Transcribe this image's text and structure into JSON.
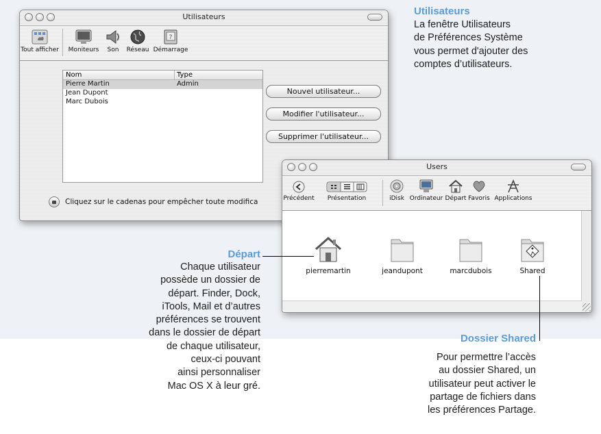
{
  "users_window": {
    "title": "Utilisateurs",
    "toolbar": [
      {
        "label": "Tout afficher",
        "icon": "show-all-icon"
      },
      {
        "label": "Moniteurs",
        "icon": "monitor-icon"
      },
      {
        "label": "Son",
        "icon": "speaker-icon"
      },
      {
        "label": "Réseau",
        "icon": "globe-icon"
      },
      {
        "label": "Démarrage",
        "icon": "startup-disk-icon"
      }
    ],
    "columns": [
      "Nom",
      "Type"
    ],
    "rows": [
      {
        "name": "Pierre Martin",
        "type": "Admin"
      },
      {
        "name": "Jean Dupont",
        "type": ""
      },
      {
        "name": "Marc Dubois",
        "type": ""
      }
    ],
    "buttons": {
      "new": "Nouvel utilisateur...",
      "edit": "Modifier l'utilisateur...",
      "delete": "Supprimer l'utilisateur..."
    },
    "lock_text": "Cliquez sur le cadenas pour empêcher toute modifica"
  },
  "finder_window": {
    "title": "Users",
    "toolbar": {
      "back": "Précédent",
      "view": "Présentation",
      "idisk": "iDisk",
      "computer": "Ordinateur",
      "home": "Départ",
      "favorites": "Favoris",
      "applications": "Applications"
    },
    "items": [
      {
        "label": "pierremartin",
        "icon": "home-folder-icon"
      },
      {
        "label": "jeandupont",
        "icon": "folder-icon"
      },
      {
        "label": "marcdubois",
        "icon": "folder-icon"
      },
      {
        "label": "Shared",
        "icon": "shared-folder-icon"
      }
    ]
  },
  "annotations": {
    "utilisateurs": {
      "title": "Utilisateurs",
      "lines": [
        "La fenêtre Utilisateurs",
        "de Préférences Système",
        "vous permet d'ajouter des",
        "comptes d’utilisateurs."
      ]
    },
    "depart": {
      "title": "Départ",
      "lines": [
        "Chaque utilisateur",
        "possède un dossier de",
        "départ. Finder, Dock,",
        "iTools, Mail et d’autres",
        "préférences se trouvent",
        "dans le dossier de départ",
        "de chaque utilisateur,",
        "ceux-ci pouvant",
        "ainsi personnaliser",
        "Mac OS X à leur gré."
      ]
    },
    "shared": {
      "title": "Dossier Shared",
      "lines": [
        "Pour permettre l’accès",
        "au dossier Shared, un",
        "utilisateur peut activer le",
        "partage de fichiers dans",
        "les préférences Partage."
      ]
    }
  },
  "colors": {
    "accent": "#5b9bd6",
    "panel": "#eef1f5"
  }
}
